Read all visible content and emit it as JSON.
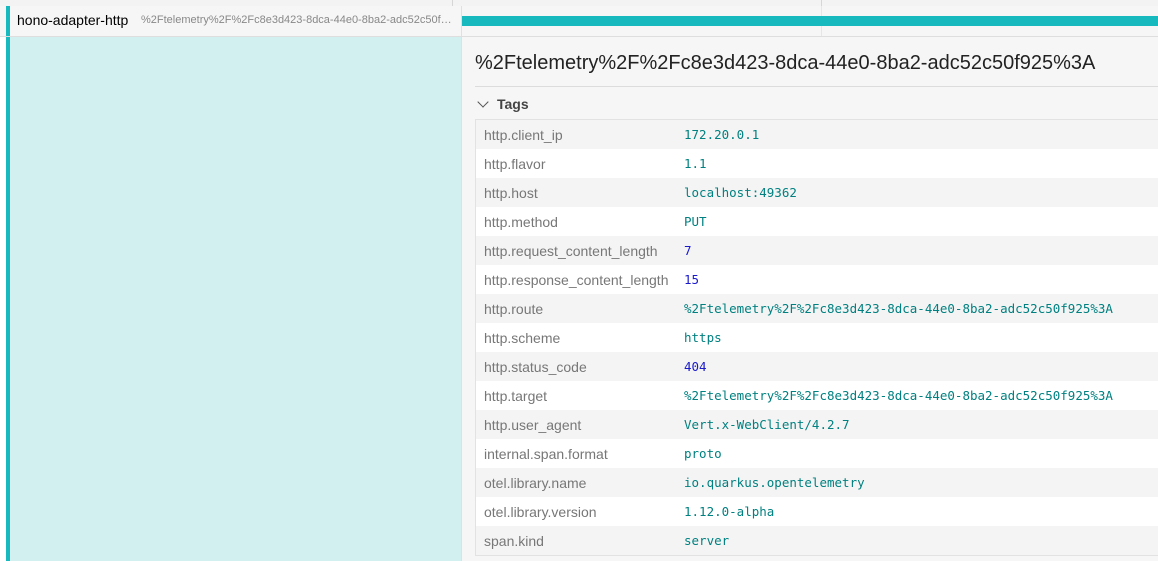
{
  "span": {
    "service_name": "hono-adapter-http",
    "operation_name": "%2Ftelemetry%2F%2Fc8e3d423-8dca-44e0-8ba2-adc52c50f925%3A"
  },
  "detail": {
    "title": "%2Ftelemetry%2F%2Fc8e3d423-8dca-44e0-8ba2-adc52c50f925%3A",
    "tags_label": "Tags",
    "tags": [
      {
        "key": "http.client_ip",
        "value": "172.20.0.1",
        "type": "string"
      },
      {
        "key": "http.flavor",
        "value": "1.1",
        "type": "string"
      },
      {
        "key": "http.host",
        "value": "localhost:49362",
        "type": "string"
      },
      {
        "key": "http.method",
        "value": "PUT",
        "type": "string"
      },
      {
        "key": "http.request_content_length",
        "value": "7",
        "type": "number"
      },
      {
        "key": "http.response_content_length",
        "value": "15",
        "type": "number"
      },
      {
        "key": "http.route",
        "value": "%2Ftelemetry%2F%2Fc8e3d423-8dca-44e0-8ba2-adc52c50f925%3A",
        "type": "string"
      },
      {
        "key": "http.scheme",
        "value": "https",
        "type": "string"
      },
      {
        "key": "http.status_code",
        "value": "404",
        "type": "number"
      },
      {
        "key": "http.target",
        "value": "%2Ftelemetry%2F%2Fc8e3d423-8dca-44e0-8ba2-adc52c50f925%3A",
        "type": "string"
      },
      {
        "key": "http.user_agent",
        "value": "Vert.x-WebClient/4.2.7",
        "type": "string"
      },
      {
        "key": "internal.span.format",
        "value": "proto",
        "type": "string"
      },
      {
        "key": "otel.library.name",
        "value": "io.quarkus.opentelemetry",
        "type": "string"
      },
      {
        "key": "otel.library.version",
        "value": "1.12.0-alpha",
        "type": "string"
      },
      {
        "key": "span.kind",
        "value": "server",
        "type": "string"
      }
    ]
  },
  "colors": {
    "accent": "#17b8be",
    "selected_bg": "#d3f0f1",
    "string_value": "#008080",
    "number_value": "#1a1acc"
  }
}
